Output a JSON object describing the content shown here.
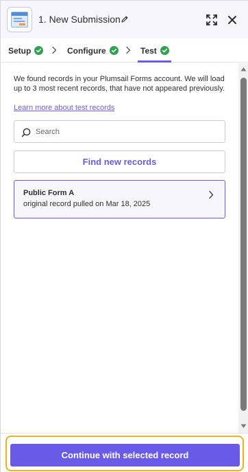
{
  "header": {
    "title": "1. New Submission",
    "app_icon": "plumsail-forms-app-icon",
    "edit_icon": "pencil-icon",
    "expand_icon": "expand-icon",
    "close_icon": "close-icon"
  },
  "tabs": [
    {
      "label": "Setup",
      "status": "complete"
    },
    {
      "label": "Configure",
      "status": "complete"
    },
    {
      "label": "Test",
      "status": "complete",
      "active": true
    }
  ],
  "test": {
    "info_text": "We found records in your Plumsail Forms account. We will load up to 3 most recent records, that have not appeared previously.",
    "learn_more_link": "Learn more about test records",
    "search_placeholder": "Search",
    "find_button": "Find new records",
    "records": [
      {
        "title": "Public Form A",
        "subtitle": "original record pulled on Mar 18, 2025"
      }
    ]
  },
  "footer": {
    "continue_button": "Continue with selected record"
  },
  "colors": {
    "accent": "#695be8",
    "success": "#2fa24f",
    "focus_ring": "#e6b422",
    "header_bg": "#f7f6fd"
  }
}
